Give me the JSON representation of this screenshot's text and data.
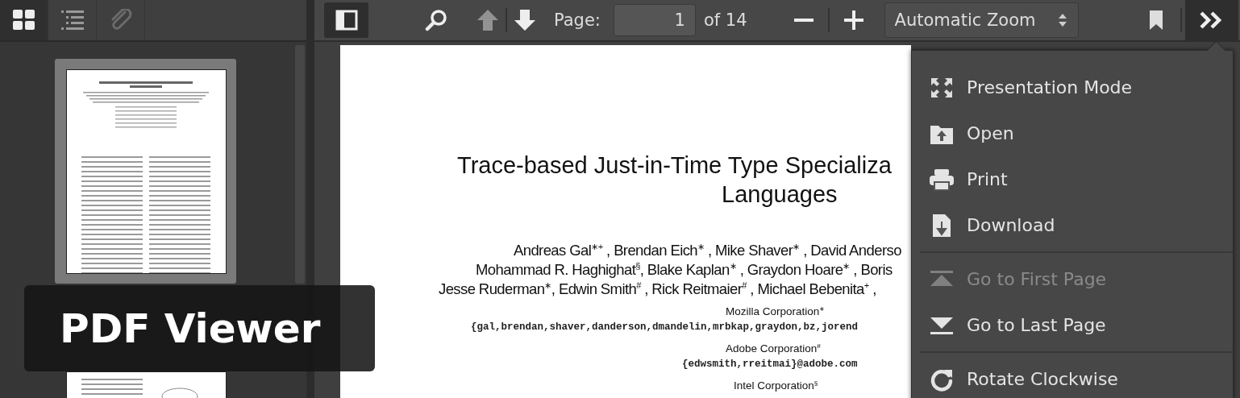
{
  "sidebar_toolbar": {
    "buttons": [
      {
        "kind": "thumbnails",
        "selected": true,
        "disabled": false
      },
      {
        "kind": "outline",
        "selected": false,
        "disabled": false
      },
      {
        "kind": "attachments",
        "selected": false,
        "disabled": true
      }
    ]
  },
  "thumbnails": [
    {
      "selected": true
    },
    {
      "selected": false
    }
  ],
  "toolbar": {
    "sidebar_toggle_on": true,
    "up_disabled": true,
    "page_label": "Page:",
    "page_number": "1",
    "page_count": "of 14",
    "zoom": "Automatic Zoom",
    "tools_open": true
  },
  "document": {
    "title_lines": [
      "Trace-based Just-in-Time Type Specializa",
      "Languages"
    ],
    "author_lines": [
      "Andreas Gal$^{∗+}$ , Brendan Eich$^{∗}$ , Mike Shaver$^{∗}$ , David Anderso",
      "Mohammad R. Haghighat$^{§}$, Blake Kaplan$^{∗}$ , Graydon Hoare$^{∗}$ , Boris",
      "Jesse Ruderman$^{∗}$, Edwin Smith$^{#}$ , Rick Reitmaier$^{#}$ , Michael Bebenita$^{+}$ ,"
    ],
    "affiliations": [
      {
        "kind": "org",
        "text": "Mozilla Corporation$^{∗}$"
      },
      {
        "kind": "email",
        "text": "{gal,brendan,shaver,danderson,dmandelin,mrbkap,graydon,bz,jorend"
      },
      {
        "kind": "org",
        "text": "Adobe Corporation$^{#}$"
      },
      {
        "kind": "email",
        "text": "{edwsmith,rreitmai}@adobe.com"
      },
      {
        "kind": "org",
        "text": "Intel Corporation$^{§}$"
      }
    ]
  },
  "menu": {
    "items": [
      {
        "kind": "presentation",
        "label": "Presentation Mode",
        "disabled": false
      },
      {
        "kind": "open",
        "label": "Open",
        "disabled": false
      },
      {
        "kind": "print",
        "label": "Print",
        "disabled": false
      },
      {
        "kind": "download",
        "label": "Download",
        "disabled": false
      },
      {
        "kind": "separator"
      },
      {
        "kind": "first",
        "label": "Go to First Page",
        "disabled": true
      },
      {
        "kind": "last",
        "label": "Go to Last Page",
        "disabled": false
      },
      {
        "kind": "separator"
      },
      {
        "kind": "rotate",
        "label": "Rotate Clockwise",
        "disabled": false
      }
    ]
  },
  "banner_title": "PDF Viewer"
}
